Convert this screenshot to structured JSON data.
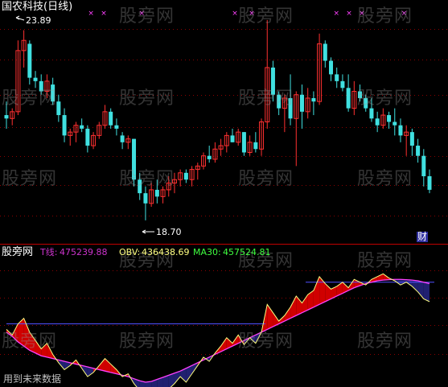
{
  "window": {
    "title": "国农科技(日线)",
    "lower_title": "股旁网",
    "bottom_note": "用到未来数据",
    "badge": "财",
    "watermark": "股旁网"
  },
  "colors": {
    "up": "#ff3030",
    "down": "#40e0e0",
    "grid": "#8b0000",
    "separator": "#c00000",
    "t_line": "#cc33cc",
    "obv_line": "#ffff80",
    "ma30_line": "#ff40ff",
    "ref_line": "#5050ff",
    "fill_above": "#d00000",
    "fill_below": "#202070",
    "title": "#ffffff",
    "marker": "#ff40ff"
  },
  "price_panel": {
    "high_label": "23.89",
    "low_label": "18.70",
    "ylim": [
      17.8,
      24.6
    ],
    "candles": [
      [
        21.4,
        21.8,
        21.0,
        21.3
      ],
      [
        21.3,
        21.6,
        21.1,
        21.5
      ],
      [
        21.5,
        23.6,
        21.4,
        23.3
      ],
      [
        23.3,
        23.9,
        22.8,
        23.6
      ],
      [
        23.5,
        23.6,
        22.3,
        22.5
      ],
      [
        22.5,
        22.7,
        22.2,
        22.4
      ],
      [
        22.4,
        22.6,
        22.0,
        22.1
      ],
      [
        22.1,
        22.6,
        21.9,
        22.4
      ],
      [
        22.3,
        22.5,
        21.7,
        21.8
      ],
      [
        21.8,
        22.0,
        21.2,
        21.4
      ],
      [
        21.4,
        21.6,
        20.6,
        20.8
      ],
      [
        20.8,
        21.0,
        20.5,
        20.9
      ],
      [
        20.9,
        21.2,
        20.6,
        21.1
      ],
      [
        21.1,
        21.3,
        20.9,
        21.0
      ],
      [
        21.0,
        21.1,
        20.3,
        20.5
      ],
      [
        20.5,
        20.9,
        20.4,
        20.8
      ],
      [
        20.8,
        21.2,
        20.7,
        21.1
      ],
      [
        21.1,
        21.7,
        21.0,
        21.5
      ],
      [
        21.5,
        21.6,
        21.0,
        21.1
      ],
      [
        21.1,
        21.3,
        20.8,
        21.0
      ],
      [
        20.8,
        20.9,
        20.4,
        20.6
      ],
      [
        20.6,
        20.8,
        20.4,
        20.7
      ],
      [
        20.7,
        20.7,
        19.3,
        19.5
      ],
      [
        19.5,
        19.7,
        18.9,
        19.1
      ],
      [
        19.1,
        19.3,
        18.3,
        18.8
      ],
      [
        18.8,
        19.4,
        18.7,
        19.2
      ],
      [
        19.2,
        19.5,
        18.8,
        19.0
      ],
      [
        19.0,
        19.3,
        18.8,
        19.2
      ],
      [
        19.2,
        19.6,
        19.0,
        19.4
      ],
      [
        19.4,
        19.7,
        19.1,
        19.5
      ],
      [
        19.5,
        19.8,
        19.3,
        19.7
      ],
      [
        19.7,
        19.8,
        19.4,
        19.5
      ],
      [
        19.5,
        19.9,
        19.3,
        19.8
      ],
      [
        19.8,
        20.0,
        19.5,
        19.9
      ],
      [
        19.9,
        20.3,
        19.8,
        20.2
      ],
      [
        20.2,
        20.5,
        20.0,
        20.1
      ],
      [
        20.1,
        20.6,
        20.0,
        20.4
      ],
      [
        20.4,
        20.7,
        20.2,
        20.5
      ],
      [
        20.5,
        20.9,
        20.3,
        20.8
      ],
      [
        20.8,
        21.0,
        20.6,
        20.6
      ],
      [
        20.6,
        21.0,
        20.5,
        20.9
      ],
      [
        20.9,
        20.9,
        20.2,
        20.3
      ],
      [
        20.3,
        20.8,
        20.2,
        20.6
      ],
      [
        20.6,
        20.9,
        20.3,
        20.4
      ],
      [
        20.4,
        21.3,
        20.2,
        21.2
      ],
      [
        21.2,
        24.2,
        21.0,
        22.8
      ],
      [
        22.8,
        23.0,
        21.8,
        22.0
      ],
      [
        22.0,
        22.1,
        21.4,
        21.6
      ],
      [
        21.6,
        22.0,
        20.9,
        21.9
      ],
      [
        21.9,
        22.6,
        21.1,
        21.3
      ],
      [
        21.3,
        22.1,
        19.9,
        22.0
      ],
      [
        22.0,
        22.3,
        21.0,
        21.5
      ],
      [
        21.5,
        22.2,
        21.3,
        21.9
      ],
      [
        21.9,
        22.1,
        21.4,
        21.8
      ],
      [
        21.8,
        23.8,
        21.7,
        23.5
      ],
      [
        23.5,
        23.6,
        22.8,
        23.0
      ],
      [
        23.0,
        23.1,
        22.4,
        22.6
      ],
      [
        22.6,
        22.8,
        22.2,
        22.4
      ],
      [
        22.4,
        22.6,
        22.1,
        22.2
      ],
      [
        22.2,
        22.6,
        21.5,
        21.6
      ],
      [
        21.6,
        22.4,
        21.4,
        22.1
      ],
      [
        22.1,
        22.3,
        21.8,
        21.9
      ],
      [
        21.9,
        22.0,
        21.5,
        21.6
      ],
      [
        21.6,
        21.9,
        21.2,
        21.3
      ],
      [
        21.3,
        21.5,
        20.9,
        21.1
      ],
      [
        21.1,
        21.6,
        21.0,
        21.4
      ],
      [
        21.4,
        21.5,
        21.0,
        21.2
      ],
      [
        21.2,
        21.6,
        20.8,
        21.1
      ],
      [
        21.1,
        21.3,
        20.6,
        20.8
      ],
      [
        20.8,
        21.1,
        20.2,
        20.9
      ],
      [
        20.9,
        21.0,
        20.2,
        20.5
      ],
      [
        20.5,
        20.7,
        20.0,
        20.2
      ],
      [
        20.2,
        20.4,
        19.3,
        19.6
      ],
      [
        19.6,
        19.8,
        19.1,
        19.2
      ]
    ]
  },
  "indicator_panel": {
    "t_label": "T线:",
    "t_value": "475239.88",
    "obv_label": "OBV:",
    "obv_value": "436438.69",
    "ma30_label": "MA30:",
    "ma30_value": "457524.81",
    "ylim": [
      -420000,
      420000
    ],
    "t_line": [
      -60000,
      -90000,
      -130000,
      -160000,
      -190000,
      -210000,
      -230000,
      -240000,
      -250000,
      -260000,
      -270000,
      -280000,
      -290000,
      -300000,
      -310000,
      -320000,
      -330000,
      -340000,
      -350000,
      -360000,
      -370000,
      -380000,
      -395000,
      -410000,
      -420000,
      -415000,
      -400000,
      -385000,
      -370000,
      -355000,
      -340000,
      -320000,
      -300000,
      -280000,
      -260000,
      -240000,
      -220000,
      -200000,
      -180000,
      -160000,
      -140000,
      -120000,
      -100000,
      -80000,
      -60000,
      -40000,
      -20000,
      0,
      20000,
      40000,
      60000,
      80000,
      100000,
      120000,
      140000,
      160000,
      180000,
      200000,
      220000,
      240000,
      260000,
      275000,
      290000,
      300000,
      310000,
      315000,
      318000,
      320000,
      320000,
      318000,
      315000,
      310000,
      300000,
      290000
    ],
    "obv_line": [
      -40000,
      -80000,
      0,
      40000,
      -60000,
      -120000,
      -180000,
      -140000,
      -220000,
      -280000,
      -330000,
      -300000,
      -260000,
      -320000,
      -380000,
      -350000,
      -300000,
      -250000,
      -290000,
      -330000,
      -380000,
      -360000,
      -430000,
      -480000,
      -560000,
      -500000,
      -540000,
      -510000,
      -470000,
      -430000,
      -380000,
      -420000,
      -360000,
      -300000,
      -240000,
      -270000,
      -210000,
      -160000,
      -100000,
      -140000,
      -80000,
      -150000,
      -100000,
      -140000,
      -60000,
      140000,
      80000,
      20000,
      60000,
      120000,
      200000,
      150000,
      210000,
      240000,
      340000,
      290000,
      250000,
      270000,
      300000,
      260000,
      320000,
      300000,
      280000,
      320000,
      340000,
      360000,
      330000,
      310000,
      280000,
      300000,
      270000,
      230000,
      180000,
      160000
    ],
    "ref_levels": [
      300000,
      0
    ],
    "bars": 74
  }
}
